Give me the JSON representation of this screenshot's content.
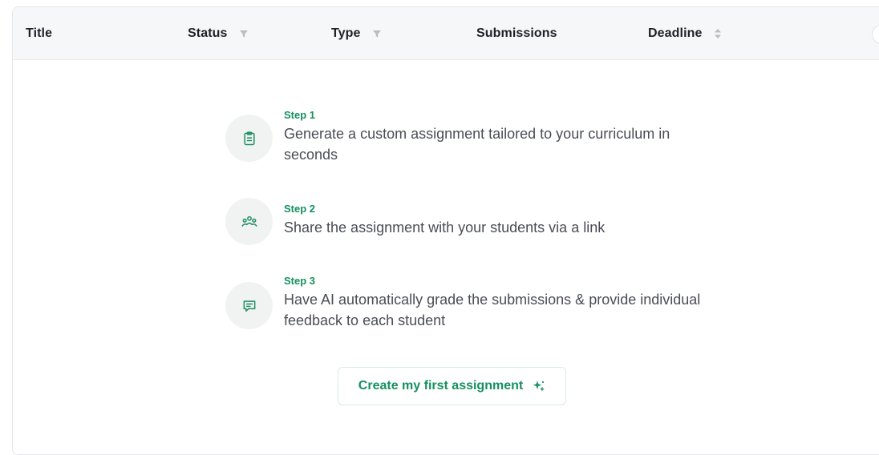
{
  "table": {
    "columns": [
      {
        "label": "Title",
        "control": "none"
      },
      {
        "label": "Status",
        "control": "filter-icon"
      },
      {
        "label": "Type",
        "control": "filter-icon"
      },
      {
        "label": "Submissions",
        "control": "none"
      },
      {
        "label": "Deadline",
        "control": "sort-icon"
      }
    ]
  },
  "empty_state": {
    "steps": [
      {
        "label": "Step 1",
        "text": "Generate a custom assignment tailored to your curriculum in seconds",
        "icon": "clipboard-list-icon"
      },
      {
        "label": "Step 2",
        "text": "Share the assignment with your students via a link",
        "icon": "users-icon"
      },
      {
        "label": "Step 3",
        "text": "Have AI automatically grade the submissions & provide individual feedback to each student",
        "icon": "message-square-icon"
      }
    ],
    "cta_label": "Create my first assignment",
    "cta_icon": "sparkles-icon"
  },
  "colors": {
    "accent": "#15905f",
    "header_bg": "#f6f7f8",
    "icon_circle_bg": "#f1f3f3"
  }
}
